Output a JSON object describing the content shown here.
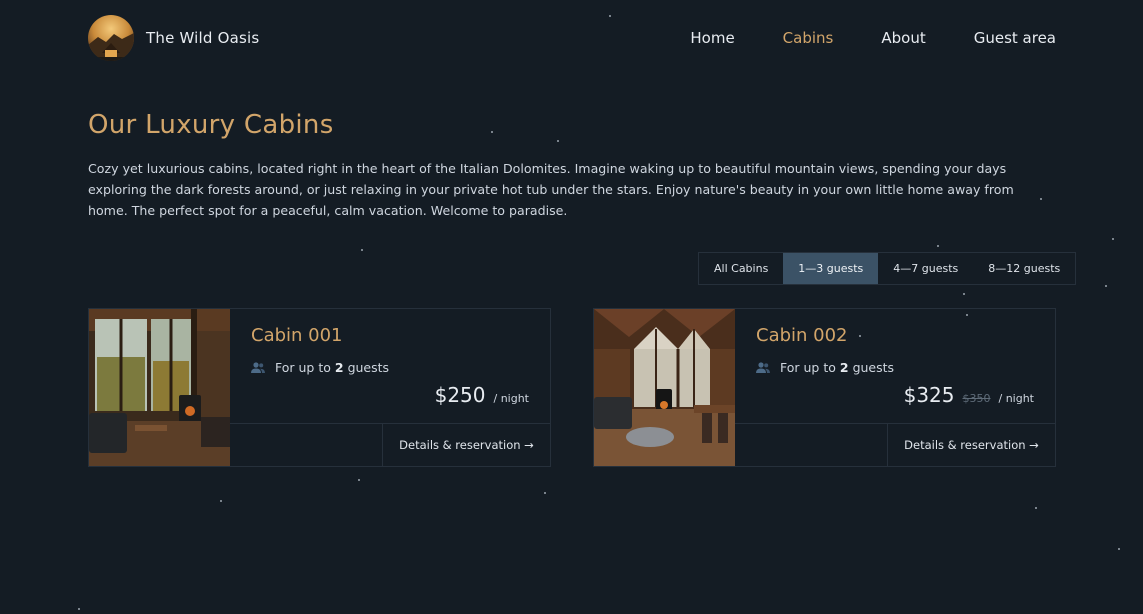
{
  "header": {
    "brand_name": "The Wild Oasis",
    "nav": [
      {
        "label": "Home",
        "active": false
      },
      {
        "label": "Cabins",
        "active": true
      },
      {
        "label": "About",
        "active": false
      },
      {
        "label": "Guest area",
        "active": false
      }
    ]
  },
  "main": {
    "title": "Our Luxury Cabins",
    "intro": "Cozy yet luxurious cabins, located right in the heart of the Italian Dolomites. Imagine waking up to beautiful mountain views, spending your days exploring the dark forests around, or just relaxing in your private hot tub under the stars. Enjoy nature's beauty in your own little home away from home. The perfect spot for a peaceful, calm vacation. Welcome to paradise."
  },
  "filter": {
    "options": [
      {
        "label": "All Cabins",
        "active": false
      },
      {
        "label": "1—3 guests",
        "active": true
      },
      {
        "label": "4—7 guests",
        "active": false
      },
      {
        "label": "8—12 guests",
        "active": false
      }
    ]
  },
  "cabins": [
    {
      "name": "Cabin 001",
      "capacity_prefix": "For up to",
      "capacity_count": "2",
      "capacity_suffix": "guests",
      "price": "$250",
      "old_price": "",
      "per_night": "/ night",
      "details_label": "Details & reservation →"
    },
    {
      "name": "Cabin 002",
      "capacity_prefix": "For up to",
      "capacity_count": "2",
      "capacity_suffix": "guests",
      "price": "$325",
      "old_price": "$350",
      "per_night": "/ night",
      "details_label": "Details & reservation →"
    }
  ],
  "colors": {
    "background": "#141c24",
    "accent": "#d2a56a",
    "active_filter": "#3b5266",
    "border": "#26303b"
  }
}
